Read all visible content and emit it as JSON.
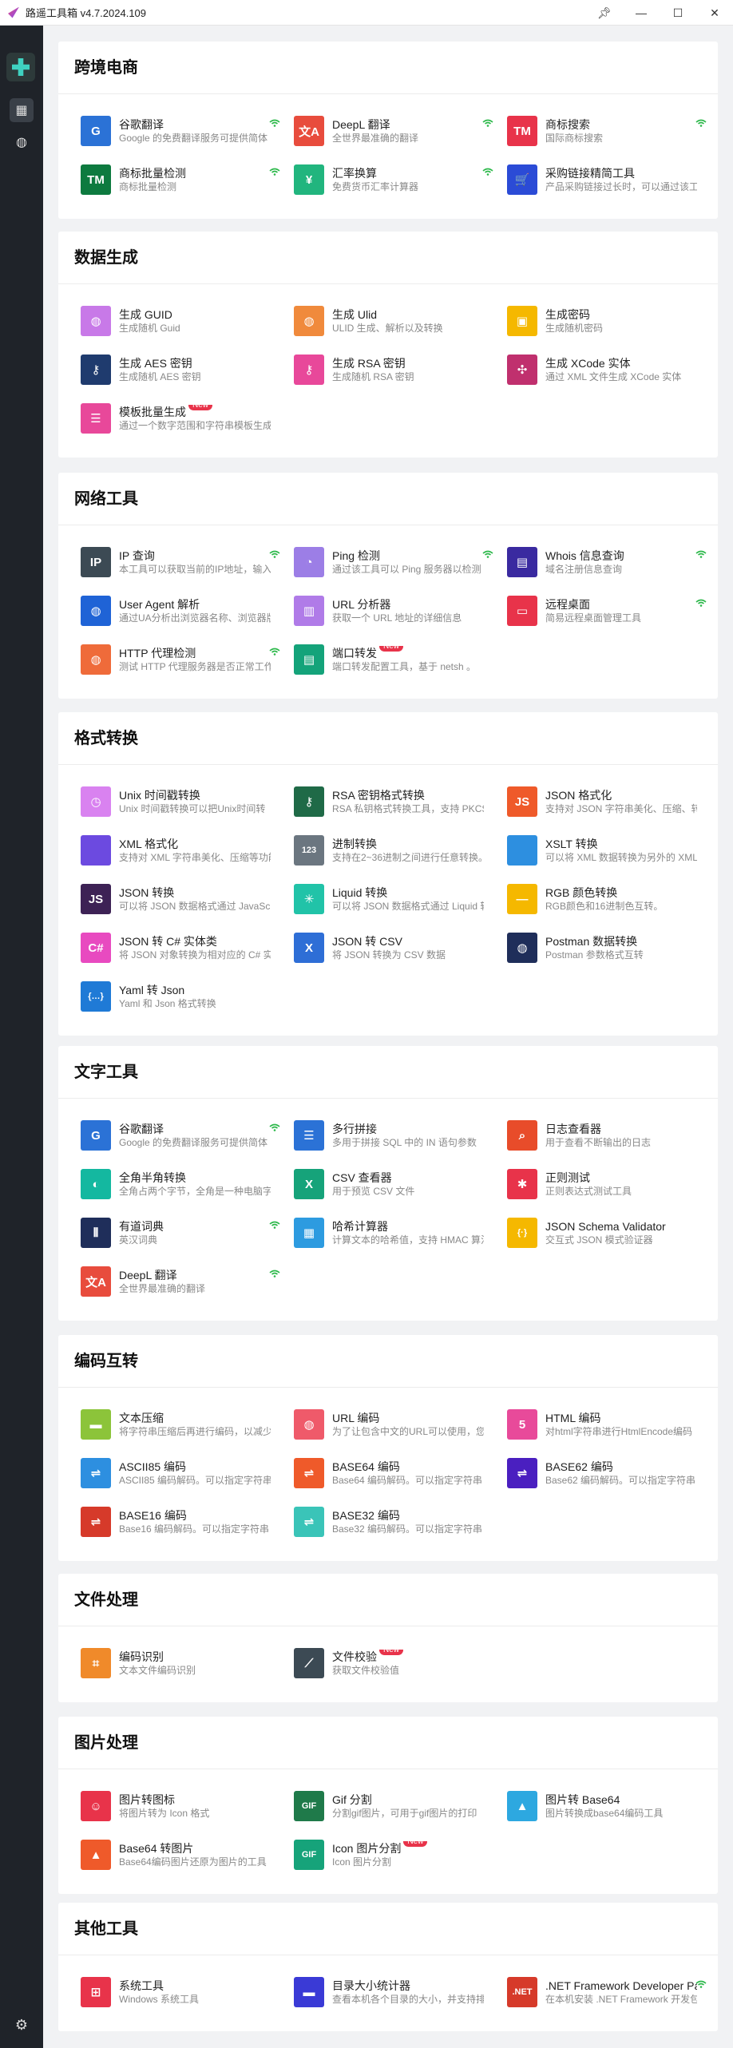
{
  "window": {
    "title": "路遥工具箱 v4.7.2024.109"
  },
  "sidebar": {
    "nav": [
      {
        "icon": "grid-icon",
        "active": true
      },
      {
        "icon": "globe-icon",
        "active": false
      }
    ],
    "settings_icon": "gear-icon"
  },
  "sections": [
    {
      "title": "跨境电商",
      "items": [
        {
          "name": "谷歌翻译",
          "desc": "Google 的免费翻译服务可提供简体",
          "icon": "google-translate-icon",
          "color": "#2b72d6",
          "glyph": "G",
          "wifi": true
        },
        {
          "name": "DeepL 翻译",
          "desc": "全世界最准确的翻译",
          "icon": "translate-icon",
          "color": "#e84c3d",
          "glyph": "文A",
          "wifi": true
        },
        {
          "name": "商标搜索",
          "desc": "国际商标搜索",
          "icon": "trademark-icon",
          "color": "#e8334a",
          "glyph": "TM",
          "wifi": true
        },
        {
          "name": "商标批量检测",
          "desc": "商标批量检测",
          "icon": "trademark-icon",
          "color": "#0d7a3f",
          "glyph": "TM",
          "wifi": true
        },
        {
          "name": "汇率换算",
          "desc": "免费货币汇率计算器",
          "icon": "yen-icon",
          "color": "#21b57e",
          "glyph": "¥",
          "wifi": true
        },
        {
          "name": "采购链接精简工具",
          "desc": "产品采购链接过长时，可以通过该工",
          "icon": "cart-icon",
          "color": "#2b4bd6",
          "glyph": "🛒"
        }
      ]
    },
    {
      "title": "数据生成",
      "items": [
        {
          "name": "生成 GUID",
          "desc": "生成随机 Guid",
          "icon": "globe-icon",
          "color": "#c879e8",
          "glyph": "◍"
        },
        {
          "name": "生成 Ulid",
          "desc": "ULID 生成、解析以及转换",
          "icon": "globe-icon",
          "color": "#f08a3c",
          "glyph": "◍"
        },
        {
          "name": "生成密码",
          "desc": "生成随机密码",
          "icon": "password-icon",
          "color": "#f5b800",
          "glyph": "▣"
        },
        {
          "name": "生成 AES 密钥",
          "desc": "生成随机 AES 密钥",
          "icon": "key-icon",
          "color": "#1f3b6e",
          "glyph": "⚷"
        },
        {
          "name": "生成 RSA 密钥",
          "desc": "生成随机 RSA 密钥",
          "icon": "key-icon",
          "color": "#e8489a",
          "glyph": "⚷"
        },
        {
          "name": "生成 XCode 实体",
          "desc": "通过 XML 文件生成 XCode 实体",
          "icon": "puzzle-icon",
          "color": "#c0306e",
          "glyph": "✣"
        },
        {
          "name": "模板批量生成",
          "desc": "通过一个数字范围和字符串模板生成",
          "icon": "template-icon",
          "color": "#e8489a",
          "glyph": "☰",
          "new": "New"
        }
      ]
    },
    {
      "title": "网络工具",
      "items": [
        {
          "name": "IP 查询",
          "desc": "本工具可以获取当前的IP地址，输入",
          "icon": "ip-icon",
          "color": "#3c4a54",
          "glyph": "IP",
          "wifi": true
        },
        {
          "name": "Ping 检测",
          "desc": "通过该工具可以 Ping 服务器以检测",
          "icon": "gauge-icon",
          "color": "#9c7ee6",
          "glyph": "◔",
          "wifi": true
        },
        {
          "name": "Whois 信息查询",
          "desc": "域名注册信息查询",
          "icon": "id-card-icon",
          "color": "#3a2aa0",
          "glyph": "▤",
          "wifi": true
        },
        {
          "name": "User Agent 解析",
          "desc": "通过UA分析出浏览器名称、浏览器版",
          "icon": "globe-icon",
          "color": "#1f63d6",
          "glyph": "◍"
        },
        {
          "name": "URL 分析器",
          "desc": "获取一个 URL 地址的详细信息",
          "icon": "chart-icon",
          "color": "#b07be8",
          "glyph": "▥"
        },
        {
          "name": "远程桌面",
          "desc": "简易远程桌面管理工具",
          "icon": "remote-desktop-icon",
          "color": "#e8334a",
          "glyph": "▭",
          "wifi": true
        },
        {
          "name": "HTTP 代理检测",
          "desc": "测试 HTTP 代理服务器是否正常工作",
          "icon": "globe-icon",
          "color": "#ef6b3a",
          "glyph": "◍",
          "wifi": true
        },
        {
          "name": "端口转发",
          "desc": "端口转发配置工具，基于 netsh 。",
          "icon": "port-icon",
          "color": "#14a37a",
          "glyph": "▤",
          "new": "New"
        }
      ]
    },
    {
      "title": "格式转换",
      "items": [
        {
          "name": "Unix 时间戳转换",
          "desc": "Unix 时间戳转换可以把Unix时间转",
          "icon": "clock-icon",
          "color": "#d982f0",
          "glyph": "◷"
        },
        {
          "name": "RSA 密钥格式转换",
          "desc": "RSA 私钥格式转换工具，支持 PKCS",
          "icon": "key-icon",
          "color": "#1f6a47",
          "glyph": "⚷"
        },
        {
          "name": "JSON 格式化",
          "desc": "支持对 JSON 字符串美化、压缩、转",
          "icon": "json-icon",
          "color": "#ef5a2a",
          "glyph": "JS"
        },
        {
          "name": "XML 格式化",
          "desc": "支持对 XML 字符串美化、压缩等功能",
          "icon": "code-icon",
          "color": "#6c4ae0",
          "glyph": "</>"
        },
        {
          "name": "进制转换",
          "desc": "支持在2~36进制之间进行任意转换。",
          "icon": "number-icon",
          "color": "#6b7680",
          "glyph": "123"
        },
        {
          "name": "XSLT 转换",
          "desc": "可以将 XML 数据转换为另外的 XML",
          "icon": "code-icon",
          "color": "#2d8fe0",
          "glyph": "</>"
        },
        {
          "name": "JSON 转换",
          "desc": "可以将 JSON 数据格式通过 JavaScript",
          "icon": "json-icon",
          "color": "#3d2255",
          "glyph": "JS"
        },
        {
          "name": "Liquid 转换",
          "desc": "可以将 JSON 数据格式通过 Liquid 转换",
          "icon": "liquid-icon",
          "color": "#21c3a8",
          "glyph": "✳"
        },
        {
          "name": "RGB 颜色转换",
          "desc": "RGB颜色和16进制色互转。",
          "icon": "color-icon",
          "color": "#f5b800",
          "glyph": "—"
        },
        {
          "name": "JSON 转 C# 实体类",
          "desc": "将 JSON 对象转换为相对应的 C# 实体",
          "icon": "csharp-icon",
          "color": "#e84ac0",
          "glyph": "C#"
        },
        {
          "name": "JSON 转 CSV",
          "desc": "将 JSON 转换为 CSV 数据",
          "icon": "excel-icon",
          "color": "#2e6ed6",
          "glyph": "X"
        },
        {
          "name": "Postman 数据转换",
          "desc": "Postman 参数格式互转",
          "icon": "globe-icon",
          "color": "#1f2e5a",
          "glyph": "◍"
        },
        {
          "name": "Yaml 转 Json",
          "desc": "Yaml 和 Json 格式转换",
          "icon": "braces-icon",
          "color": "#1f7ad6",
          "glyph": "{…}"
        }
      ]
    },
    {
      "title": "文字工具",
      "items": [
        {
          "name": "谷歌翻译",
          "desc": "Google 的免费翻译服务可提供简体",
          "icon": "google-translate-icon",
          "color": "#2b72d6",
          "glyph": "G",
          "wifi": true
        },
        {
          "name": "多行拼接",
          "desc": "多用于拼接 SQL 中的 IN 语句参数",
          "icon": "list-icon",
          "color": "#2b72d6",
          "glyph": "☰"
        },
        {
          "name": "日志查看器",
          "desc": "用于查看不断输出的日志",
          "icon": "search-icon",
          "color": "#e84c2a",
          "glyph": "⌕"
        },
        {
          "name": "全角半角转换",
          "desc": "全角占两个字节，全角是一种电脑字",
          "icon": "contrast-icon",
          "color": "#14b8a0",
          "glyph": "◐"
        },
        {
          "name": "CSV 查看器",
          "desc": "用于预览 CSV 文件",
          "icon": "excel-icon",
          "color": "#16a37a",
          "glyph": "X"
        },
        {
          "name": "正则测试",
          "desc": "正则表达式测试工具",
          "icon": "asterisk-icon",
          "color": "#e8334a",
          "glyph": "✱"
        },
        {
          "name": "有道词典",
          "desc": "英汉词典",
          "icon": "books-icon",
          "color": "#1f2e5a",
          "glyph": "⫴",
          "wifi": true
        },
        {
          "name": "哈希计算器",
          "desc": "计算文本的哈希值，支持 HMAC 算法",
          "icon": "calculator-icon",
          "color": "#2d9be0",
          "glyph": "▦"
        },
        {
          "name": "JSON Schema Validator",
          "desc": "交互式 JSON 模式验证器",
          "icon": "braces-icon",
          "color": "#f5b800",
          "glyph": "{·}"
        },
        {
          "name": "DeepL 翻译",
          "desc": "全世界最准确的翻译",
          "icon": "translate-icon",
          "color": "#e84c3d",
          "glyph": "文A",
          "wifi": true
        }
      ]
    },
    {
      "title": "编码互转",
      "items": [
        {
          "name": "文本压缩",
          "desc": "将字符串压缩后再进行编码，以减少",
          "icon": "compress-icon",
          "color": "#8cc43a",
          "glyph": "▬"
        },
        {
          "name": "URL 编码",
          "desc": "为了让包含中文的URL可以使用，您",
          "icon": "globe-icon",
          "color": "#ef5a6a",
          "glyph": "◍"
        },
        {
          "name": "HTML 编码",
          "desc": "对html字符串进行HtmlEncode编码",
          "icon": "html-icon",
          "color": "#e84a9a",
          "glyph": "5"
        },
        {
          "name": "ASCII85 编码",
          "desc": "ASCII85 编码解码。可以指定字符串",
          "icon": "encode-icon",
          "color": "#2d8fe0",
          "glyph": "⇌"
        },
        {
          "name": "BASE64 编码",
          "desc": "Base64 编码解码。可以指定字符串",
          "icon": "encode-icon",
          "color": "#ef5a2a",
          "glyph": "⇌"
        },
        {
          "name": "BASE62 编码",
          "desc": "Base62 编码解码。可以指定字符串",
          "icon": "encode-icon",
          "color": "#4a1fc0",
          "glyph": "⇌"
        },
        {
          "name": "BASE16 编码",
          "desc": "Base16 编码解码。可以指定字符串",
          "icon": "encode-icon",
          "color": "#d63a2a",
          "glyph": "⇌"
        },
        {
          "name": "BASE32 编码",
          "desc": "Base32 编码解码。可以指定字符串",
          "icon": "encode-icon",
          "color": "#3ac4b8",
          "glyph": "⇌"
        }
      ]
    },
    {
      "title": "文件处理",
      "items": [
        {
          "name": "编码识别",
          "desc": "文本文件编码识别",
          "icon": "scan-icon",
          "color": "#f08a2a",
          "glyph": "⌗"
        },
        {
          "name": "文件校验",
          "desc": "获取文件校验值",
          "icon": "checksum-icon",
          "color": "#3c4a54",
          "glyph": "⟋",
          "new": "New"
        }
      ]
    },
    {
      "title": "图片处理",
      "items": [
        {
          "name": "图片转图标",
          "desc": "将图片转为 Icon 格式",
          "icon": "smile-icon",
          "color": "#e8334a",
          "glyph": "☺"
        },
        {
          "name": "Gif 分割",
          "desc": "分割gif图片，可用于gif图片的打印",
          "icon": "gif-icon",
          "color": "#1f7a4a",
          "glyph": "GIF"
        },
        {
          "name": "图片转 Base64",
          "desc": "图片转换成base64编码工具",
          "icon": "image-file-icon",
          "color": "#2da8e0",
          "glyph": "▲"
        },
        {
          "name": "Base64 转图片",
          "desc": "Base64编码图片还原为图片的工具",
          "icon": "image-file-icon",
          "color": "#ef5a2a",
          "glyph": "▲"
        },
        {
          "name": "Icon 图片分割",
          "desc": "Icon 图片分割",
          "icon": "gif-icon",
          "color": "#16a37a",
          "glyph": "GIF",
          "new": "New"
        }
      ]
    },
    {
      "title": "其他工具",
      "items": [
        {
          "name": "系统工具",
          "desc": "Windows 系统工具",
          "icon": "windows-icon",
          "color": "#e8334a",
          "glyph": "⊞"
        },
        {
          "name": "目录大小统计器",
          "desc": "查看本机各个目录的大小，并支持排",
          "icon": "folder-icon",
          "color": "#3a3ad6",
          "glyph": "▬"
        },
        {
          "name": ".NET Framework Developer Pack",
          "desc": "在本机安装 .NET Framework 开发包",
          "icon": "dotnet-icon",
          "color": "#d63a2a",
          "glyph": ".NET",
          "wifi": true
        }
      ]
    }
  ]
}
